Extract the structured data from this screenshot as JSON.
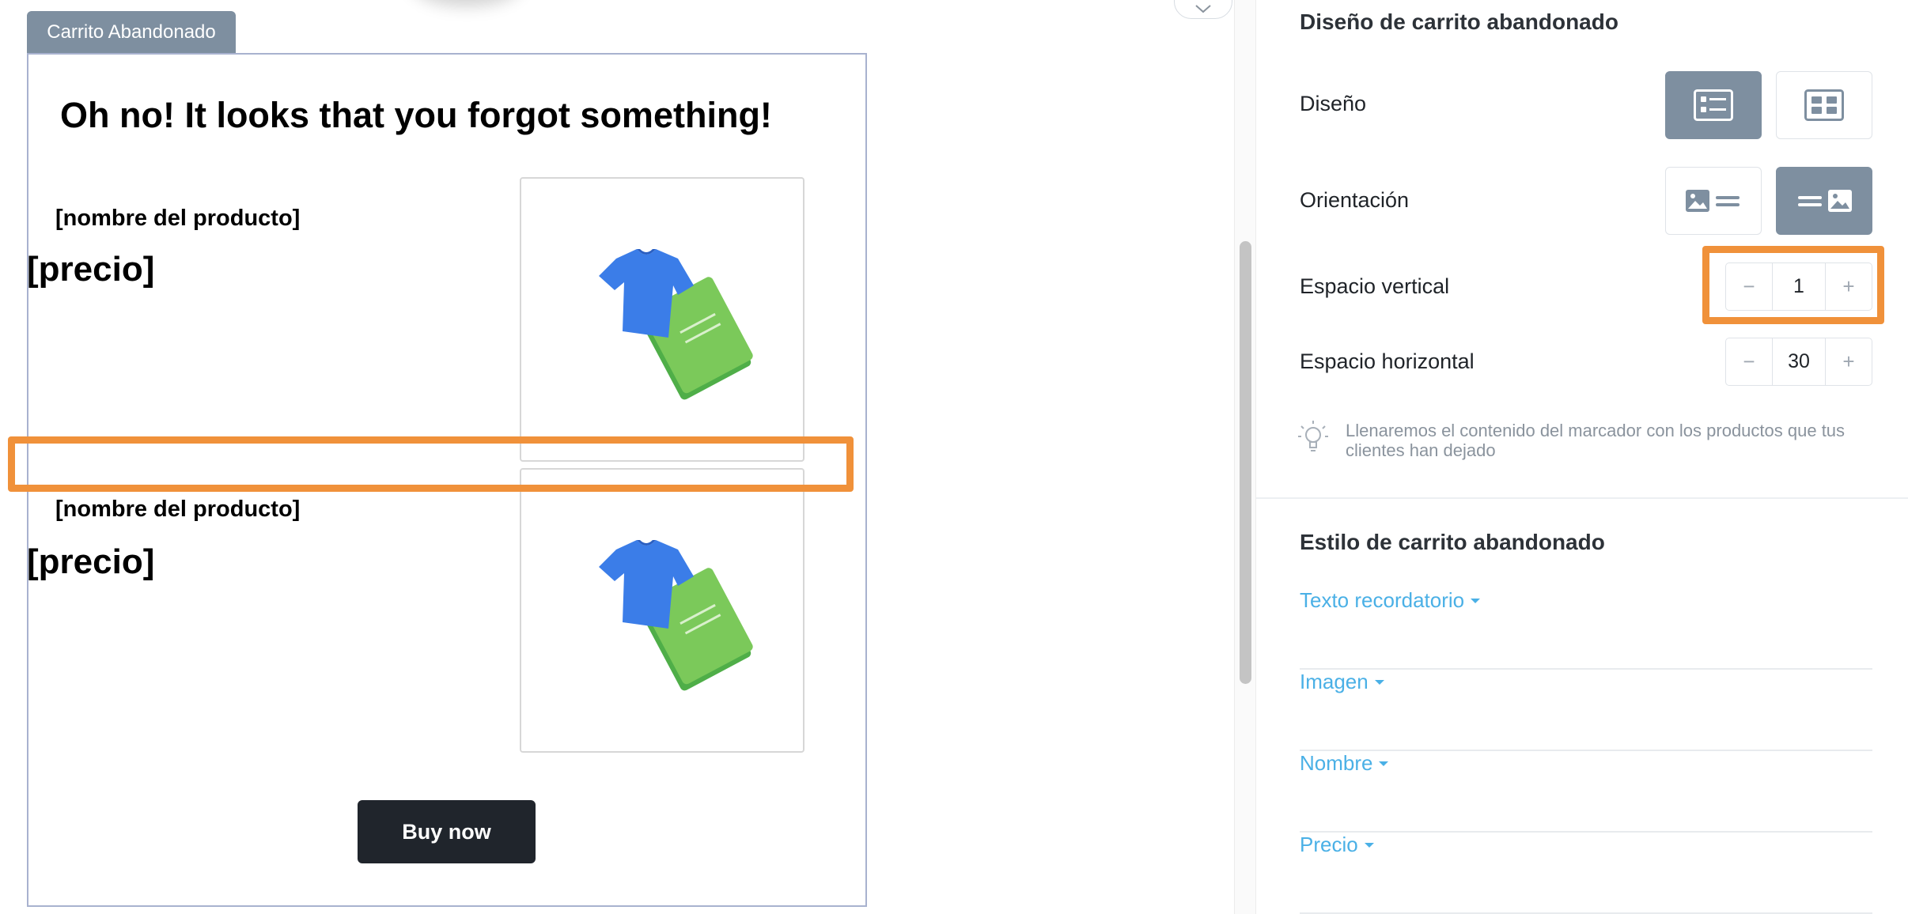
{
  "canvas": {
    "block_tag": "Carrito Abandonado",
    "heading": "Oh no! It looks that you forgot something!",
    "products": [
      {
        "name": "[nombre del producto]",
        "price": "[precio]",
        "image_icon": "tshirt-book-icon"
      },
      {
        "name": "[nombre del producto]",
        "price": "[precio]",
        "image_icon": "tshirt-book-icon"
      }
    ],
    "buy_button": "Buy now",
    "highlight_color": "#f0913a"
  },
  "panel": {
    "design_title": "Diseño de carrito abandonado",
    "design_label": "Diseño",
    "design_options": [
      {
        "icon": "list-layout-icon",
        "active": true
      },
      {
        "icon": "grid-layout-icon",
        "active": false
      }
    ],
    "orientation_label": "Orientación",
    "orientation_options": [
      {
        "icon": "image-left-icon",
        "active": false
      },
      {
        "icon": "image-right-icon",
        "active": true
      }
    ],
    "vertical_spacing": {
      "label": "Espacio vertical",
      "value": "1",
      "minus": "−",
      "plus": "+"
    },
    "horizontal_spacing": {
      "label": "Espacio horizontal",
      "value": "30",
      "minus": "−",
      "plus": "+"
    },
    "hint": "Llenaremos el contenido del marcador con los productos que tus clientes han dejado",
    "style_title": "Estilo de carrito abandonado",
    "style_sections": [
      "Texto recordatorio",
      "Imagen",
      "Nombre",
      "Precio"
    ],
    "accent_color": "#4ab0e6",
    "active_button_color": "#7e8fa0"
  }
}
